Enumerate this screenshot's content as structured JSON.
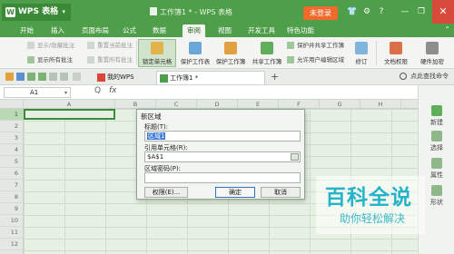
{
  "titlebar": {
    "app_label": "WPS 表格",
    "doc_title": "工作簿1 * - WPS 表格",
    "login_label": "未登录"
  },
  "menu": {
    "tabs": [
      "开始",
      "插入",
      "页面布局",
      "公式",
      "数据",
      "审阅",
      "视图",
      "开发工具",
      "特色功能"
    ],
    "active": "审阅"
  },
  "ribbon": {
    "show_hide_comment": "显示/隐藏批注",
    "reset_current_comment": "重置当前批注",
    "show_all_comments": "显示所有批注",
    "reset_all_comments": "重置所有批注",
    "lock_cell": "锁定单元格",
    "protect_sheet": "保护工作表",
    "protect_workbook": "保护工作簿",
    "share_workbook": "共享工作簿",
    "protect_share_workbook": "保护并共享工作簿",
    "allow_edit_ranges": "允许用户编辑区域",
    "track_changes": "修订",
    "doc_permission": "文档权限",
    "hardware_encrypt": "硬件加密"
  },
  "tabs_bar": {
    "home_tab": "我的WPS",
    "doc_tab": "工作簿1 *",
    "search_tag": "点此查找命令"
  },
  "formula": {
    "name_box": "A1",
    "fx_symbol": "fx",
    "zoom_symbol": "Q"
  },
  "grid": {
    "columns": [
      "A",
      "B",
      "C",
      "D",
      "E",
      "F",
      "G",
      "H",
      "I",
      "J"
    ],
    "rows": [
      "1",
      "2",
      "3",
      "4",
      "5",
      "6",
      "7",
      "8",
      "9",
      "10",
      "11",
      "12"
    ],
    "active_row": "1"
  },
  "right_panel": {
    "items": [
      "新建",
      "选择",
      "属性",
      "形状"
    ]
  },
  "dialog": {
    "title": "新区域",
    "title_label": "标题(T):",
    "title_value": "区域1",
    "ref_label": "引用单元格(R):",
    "ref_value": "$A$1",
    "password_label": "区域密码(P):",
    "password_value": "",
    "permissions_button": "权限(E)...",
    "ok_button": "确定",
    "cancel_button": "取消"
  },
  "watermark": {
    "title": "百科全说",
    "subtitle": "助你轻松解决"
  },
  "colors": {
    "brand_green": "#4f9e4a",
    "login_orange": "#f06a2c",
    "grid_green": "#e6f1e3",
    "watermark_cyan": "#26b3c9"
  }
}
